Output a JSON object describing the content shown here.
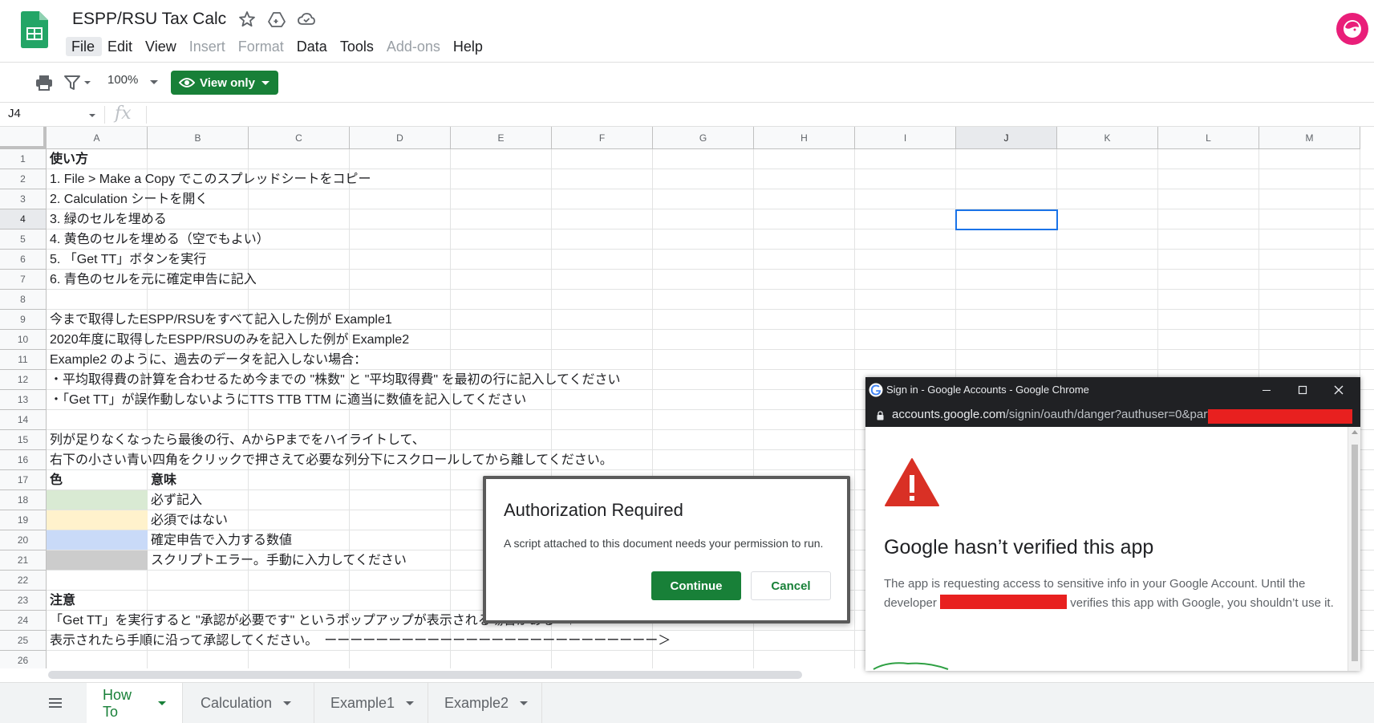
{
  "header": {
    "doc_title": "ESPP/RSU Tax Calc",
    "menu": [
      {
        "label": "File",
        "disabled": false
      },
      {
        "label": "Edit",
        "disabled": false
      },
      {
        "label": "View",
        "disabled": false
      },
      {
        "label": "Insert",
        "disabled": true
      },
      {
        "label": "Format",
        "disabled": true
      },
      {
        "label": "Data",
        "disabled": false
      },
      {
        "label": "Tools",
        "disabled": false
      },
      {
        "label": "Add-ons",
        "disabled": true
      },
      {
        "label": "Help",
        "disabled": false
      }
    ]
  },
  "toolbar": {
    "zoom": "100%",
    "view_only_label": "View only"
  },
  "formula_bar": {
    "name_box": "J4",
    "fx_label": "fx"
  },
  "grid": {
    "columns": [
      "A",
      "B",
      "C",
      "D",
      "E",
      "F",
      "G",
      "H",
      "I",
      "J",
      "K",
      "L",
      "M"
    ],
    "selected_column": "J",
    "rows": [
      "1",
      "2",
      "3",
      "4",
      "5",
      "6",
      "7",
      "8",
      "9",
      "10",
      "11",
      "12",
      "13",
      "14",
      "15",
      "16",
      "17",
      "18",
      "19",
      "20",
      "21",
      "22",
      "23",
      "24",
      "25",
      "26"
    ],
    "selected_row": "4",
    "selected_cell": "J4",
    "cells": {
      "a1": "使い方",
      "a2": "1. File > Make a Copy でこのスプレッドシートをコピー",
      "a3": "2. Calculation シートを開く",
      "a4": "3. 緑のセルを埋める",
      "a5": "4. 黄色のセルを埋める（空でもよい）",
      "a6": "5. 「Get TT」ボタンを実行",
      "a7": "6. 青色のセルを元に確定申告に記入",
      "a9": "今まで取得したESPP/RSUをすべて記入した例が Example1",
      "a10": "2020年度に取得したESPP/RSUのみを記入した例が Example2",
      "a11": "Example2 のように、過去のデータを記入しない場合：",
      "a12": "・平均取得費の計算を合わせるため今までの \"株数\" と \"平均取得費\" を最初の行に記入してください",
      "a13": "・「Get TT」が誤作動しないようにTTS TTB TTM に適当に数値を記入してください",
      "a15": "列が足りなくなったら最後の行、AからPまでをハイライトして、",
      "a16": "右下の小さい青い四角をクリックで押さえて必要な列分下にスクロールしてから離してください。",
      "a18": "色",
      "b18": "意味",
      "b19": "必ず記入",
      "b20": "必須ではない",
      "b21": "確定申告で入力する数値",
      "b22": "スクリプトエラー。手動に入力してください",
      "a24": "注意",
      "a25": "「Get TT」を実行すると \"承認が必要です\" というポップアップが表示される場合がある　↑",
      "a26": "表示されたら手順に沿って承認してください。　ーーーーーーーーーーーーーーーーーーーーーーーーーー＞"
    },
    "swatch_colors": {
      "a19": "#d9ead3",
      "a20": "#fff2cc",
      "a21": "#c9daf8",
      "a22": "#cccccc"
    }
  },
  "sheet_tabs": [
    {
      "label": "How To",
      "active": true
    },
    {
      "label": "Calculation",
      "active": false
    },
    {
      "label": "Example1",
      "active": false
    },
    {
      "label": "Example2",
      "active": false
    }
  ],
  "auth_dialog": {
    "title": "Authorization Required",
    "body": "A script attached to this document needs your permission to run.",
    "continue_label": "Continue",
    "cancel_label": "Cancel"
  },
  "chrome_popup": {
    "window_title": "Sign in - Google Accounts - Google Chrome",
    "url_host": "accounts.google.com",
    "url_path": "/signin/oauth/danger?authuser=0&part=",
    "heading": "Google hasn’t verified this app",
    "body_before": "The app is requesting access to sensitive info in your Google Account. Until the developer",
    "body_after": "verifies this app with Google, you shouldn’t use it."
  },
  "colors": {
    "accent_green": "#188038",
    "warning_red": "#d93025",
    "redaction_red": "#e8201f",
    "avatar_pink": "#e91e79",
    "selection_blue": "#1a73e8"
  }
}
